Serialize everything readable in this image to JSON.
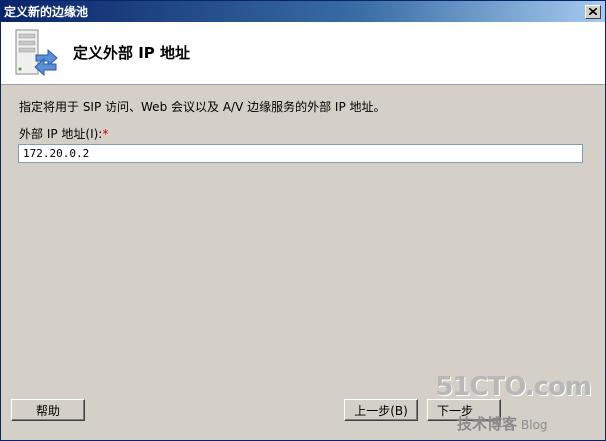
{
  "window": {
    "title": "定义新的边缘池",
    "close_icon": "close-icon"
  },
  "header": {
    "title": "定义外部 IP 地址",
    "icon": "server-arrow-icon"
  },
  "main": {
    "description": "指定将用于 SIP 访问、Web 会议以及 A/V 边缘服务的外部 IP 地址。",
    "field_label": "外部 IP 地址(I):",
    "required_mark": "*",
    "ip_value": "172.20.0.2"
  },
  "buttons": {
    "help": "帮助",
    "back": "上一步(B)",
    "next": "下一步"
  },
  "watermark": {
    "main": "51CTO.com",
    "sub": "技术博客",
    "blog": "Blog"
  },
  "colors": {
    "titlebar_start": "#0a246a",
    "titlebar_end": "#a6caf0",
    "dialog_bg": "#d4d0c8",
    "required": "#d00000"
  }
}
